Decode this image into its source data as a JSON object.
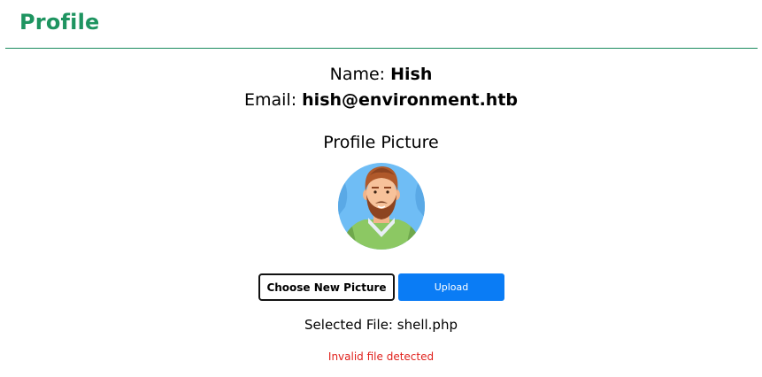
{
  "header": {
    "title": "Profile"
  },
  "profile": {
    "name_label": "Name:",
    "name_value": "Hish",
    "email_label": "Email:",
    "email_value": "hish@environment.htb",
    "picture_heading": "Profile Picture"
  },
  "actions": {
    "choose_label": "Choose New Picture",
    "upload_label": "Upload"
  },
  "status": {
    "selected_label": "Selected File:",
    "selected_file": "shell.php",
    "error": "Invalid file detected"
  },
  "colors": {
    "title": "#1e9460",
    "divider": "#1a8a5e",
    "upload_button": "#0a7cf5",
    "error_text": "#e0201b"
  },
  "icons": {
    "avatar": "bearded-man-avatar"
  }
}
